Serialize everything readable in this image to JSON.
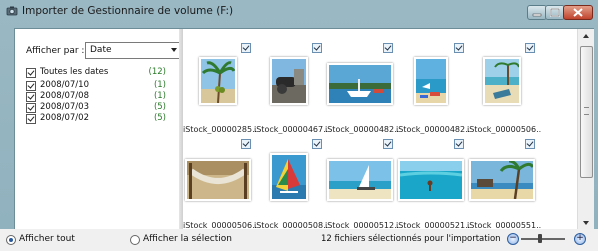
{
  "window": {
    "title": "Importer de Gestionnaire de volume (F:)"
  },
  "left_pane": {
    "show_by_label": "Afficher par :",
    "show_by_value": "Date",
    "dates": [
      {
        "label": "Toutes les dates",
        "count": "(12)",
        "checked": true
      },
      {
        "label": "2008/07/10",
        "count": "(1)",
        "checked": true
      },
      {
        "label": "2008/07/08",
        "count": "(1)",
        "checked": true
      },
      {
        "label": "2008/07/03",
        "count": "(5)",
        "checked": true
      },
      {
        "label": "2008/07/02",
        "count": "(5)",
        "checked": true
      }
    ]
  },
  "thumbnails": [
    {
      "name": "iStock_00000285...",
      "checked": true,
      "subject": "palm-tree-coconuts"
    },
    {
      "name": "iStock_00000467...",
      "checked": true,
      "subject": "cannon-fort"
    },
    {
      "name": "iStock_00000482...",
      "checked": true,
      "subject": "boat-harbor"
    },
    {
      "name": "iStock_00000482...",
      "checked": true,
      "subject": "beach-boats"
    },
    {
      "name": "iStock_00000506...",
      "checked": true,
      "subject": "beach-chair"
    },
    {
      "name": "iStock_00000506...",
      "checked": true,
      "subject": "hammock"
    },
    {
      "name": "iStock_00000508...",
      "checked": true,
      "subject": "windsurf-sail"
    },
    {
      "name": "iStock_00000512...",
      "checked": true,
      "subject": "catamaran-beach"
    },
    {
      "name": "iStock_00000521...",
      "checked": true,
      "subject": "swimmer-lagoon"
    },
    {
      "name": "iStock_00000551...",
      "checked": true,
      "subject": "palm-sunset-beach"
    }
  ],
  "status": {
    "show_all_label": "Afficher tout",
    "show_selection_label": "Afficher la sélection",
    "summary": "12 fichiers sélectionnés pour l'importation",
    "zoom_level": 0.42
  },
  "colors": {
    "title_bar": "#9ab8c4",
    "count_green": "#2a7a2a",
    "close_button": "#c0432d"
  }
}
